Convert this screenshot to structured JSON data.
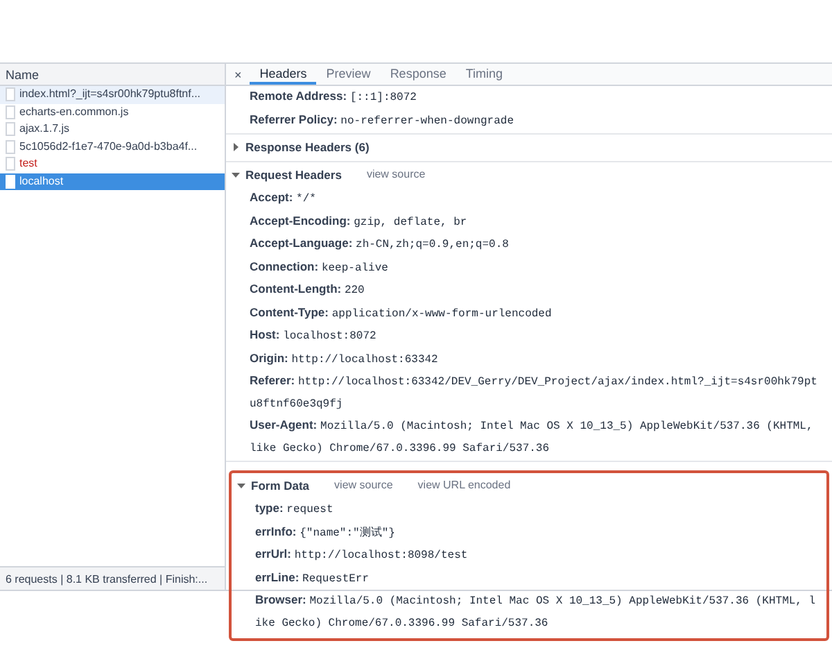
{
  "requests": {
    "column": "Name",
    "rows": [
      {
        "name": "index.html?_ijt=s4sr00hk79ptu8ftnf...",
        "selected": false,
        "hovered": true,
        "error": false
      },
      {
        "name": "echarts-en.common.js",
        "selected": false,
        "hovered": false,
        "error": false
      },
      {
        "name": "ajax.1.7.js",
        "selected": false,
        "hovered": false,
        "error": false
      },
      {
        "name": "5c1056d2-f1e7-470e-9a0d-b3ba4f...",
        "selected": false,
        "hovered": false,
        "error": false
      },
      {
        "name": "test",
        "selected": false,
        "hovered": false,
        "error": true
      },
      {
        "name": "localhost",
        "selected": true,
        "hovered": false,
        "error": false
      }
    ],
    "status_bar": "6 requests | 8.1 KB transferred | Finish:..."
  },
  "detail": {
    "close": "×",
    "tabs": [
      {
        "label": "Headers",
        "selected": true
      },
      {
        "label": "Preview",
        "selected": false
      },
      {
        "label": "Response",
        "selected": false
      },
      {
        "label": "Timing",
        "selected": false
      }
    ],
    "sections": [
      {
        "fields": [
          {
            "key": "Remote Address:",
            "value": "[::1]:8072"
          },
          {
            "key": "Referrer Policy:",
            "value": "no-referrer-when-downgrade"
          }
        ]
      },
      {
        "title": "Response Headers (6)",
        "expanded": false
      },
      {
        "title": "Request Headers",
        "expanded": true,
        "links": [
          "view source"
        ],
        "fields": [
          {
            "key": "Accept:",
            "value": "*/*"
          },
          {
            "key": "Accept-Encoding:",
            "value": "gzip, deflate, br"
          },
          {
            "key": "Accept-Language:",
            "value": "zh-CN,zh;q=0.9,en;q=0.8"
          },
          {
            "key": "Connection:",
            "value": "keep-alive"
          },
          {
            "key": "Content-Length:",
            "value": "220"
          },
          {
            "key": "Content-Type:",
            "value": "application/x-www-form-urlencoded"
          },
          {
            "key": "Host:",
            "value": "localhost:8072"
          },
          {
            "key": "Origin:",
            "value": "http://localhost:63342"
          },
          {
            "key": "Referer:",
            "value": "http://localhost:63342/DEV_Gerry/DEV_Project/ajax/index.html?_ijt=s4sr00hk79ptu8ftnf60e3q9fj"
          },
          {
            "key": "User-Agent:",
            "value": "Mozilla/5.0 (Macintosh; Intel Mac OS X 10_13_5) AppleWebKit/537.36 (KHTML, like Gecko) Chrome/67.0.3396.99 Safari/537.36"
          }
        ]
      },
      {
        "title": "Form Data",
        "expanded": true,
        "highlighted": true,
        "links": [
          "view source",
          "view URL encoded"
        ],
        "fields": [
          {
            "key": "type:",
            "value": "request"
          },
          {
            "key": "errInfo:",
            "value": "{\"name\":\"测试\"}"
          },
          {
            "key": "errUrl:",
            "value": "http://localhost:8098/test"
          },
          {
            "key": "errLine:",
            "value": "RequestErr"
          },
          {
            "key": "Browser:",
            "value": "Mozilla/5.0 (Macintosh; Intel Mac OS X 10_13_5) AppleWebKit/537.36 (KHTML, like Gecko) Chrome/67.0.3396.99 Safari/537.36"
          }
        ]
      }
    ]
  }
}
